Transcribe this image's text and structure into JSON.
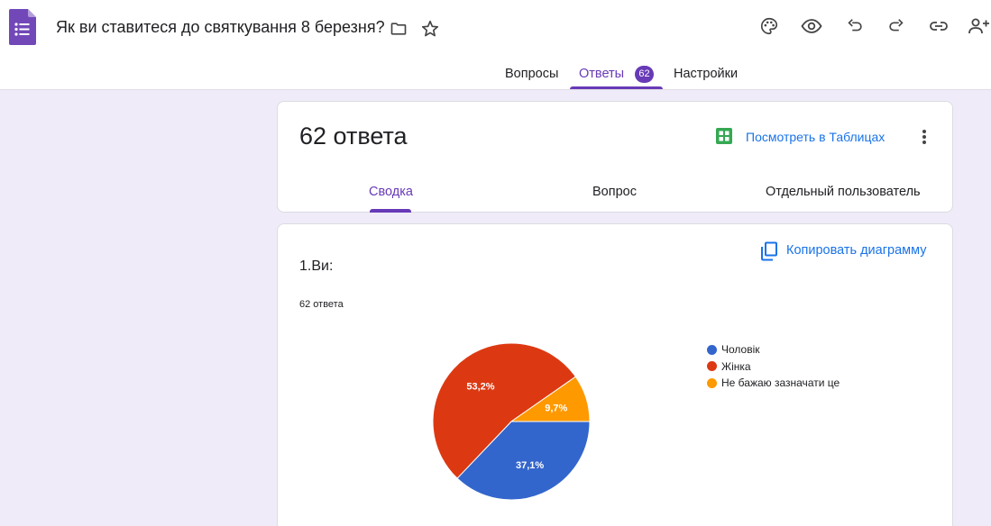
{
  "header": {
    "title": "Як ви ставитеся до святкування 8 березня?",
    "tabs": [
      {
        "label": "Вопросы"
      },
      {
        "label": "Ответы",
        "badge": "62"
      },
      {
        "label": "Настройки"
      }
    ]
  },
  "summary": {
    "count_title": "62 ответа",
    "view_in_sheets": "Посмотреть в Таблицах",
    "sub_tabs": [
      "Сводка",
      "Вопрос",
      "Отдельный пользователь"
    ]
  },
  "question": {
    "title": "1.Ви:",
    "count": "62 ответа",
    "copy_chart": "Копировать диаграмму"
  },
  "chart_data": {
    "type": "pie",
    "categories": [
      "Чоловік",
      "Жінка",
      "Не бажаю зазначати це"
    ],
    "values": [
      37.1,
      53.2,
      9.7
    ],
    "labels": [
      "37,1%",
      "53,2%",
      "9,7%"
    ],
    "colors": [
      "#3366cc",
      "#dc3912",
      "#ff9900"
    ],
    "legend_position": "right"
  },
  "colors": {
    "accent": "#673ab7",
    "link": "#1a73e8",
    "background": "#f0ebf8"
  }
}
